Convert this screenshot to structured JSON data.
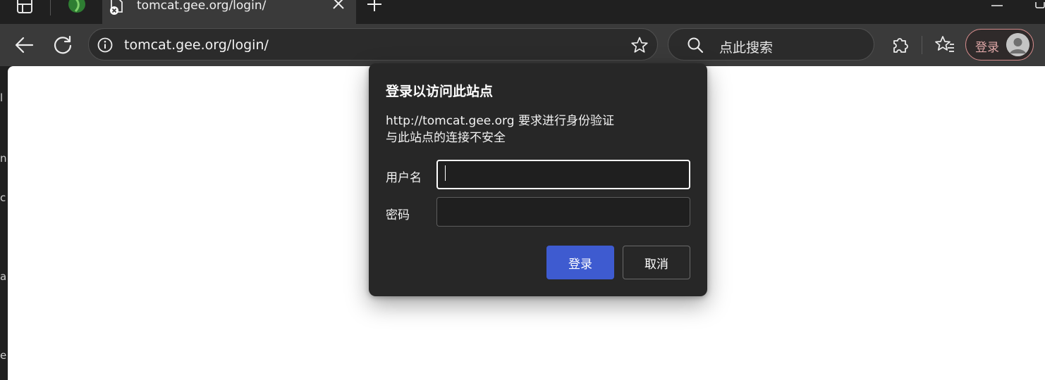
{
  "tabs": {
    "active_title": "tomcat.gee.org/login/"
  },
  "toolbar": {
    "url": "tomcat.gee.org/login/",
    "search_placeholder": "点此搜索",
    "profile_label": "登录"
  },
  "dialog": {
    "title": "登录以访问此站点",
    "line1": "http://tomcat.gee.org 要求进行身份验证",
    "line2": "与此站点的连接不安全",
    "username_label": "用户名",
    "username_value": "",
    "password_label": "密码",
    "password_value": "",
    "login_button": "登录",
    "cancel_button": "取消"
  },
  "left_edge_fragments": [
    "l",
    "n",
    "c",
    "a",
    "e"
  ],
  "colors": {
    "primary_button": "#3e5bd0",
    "dialog_bg": "#272727",
    "toolbar_bg": "#3a3a3a",
    "profile_accent": "#d28a8a"
  }
}
